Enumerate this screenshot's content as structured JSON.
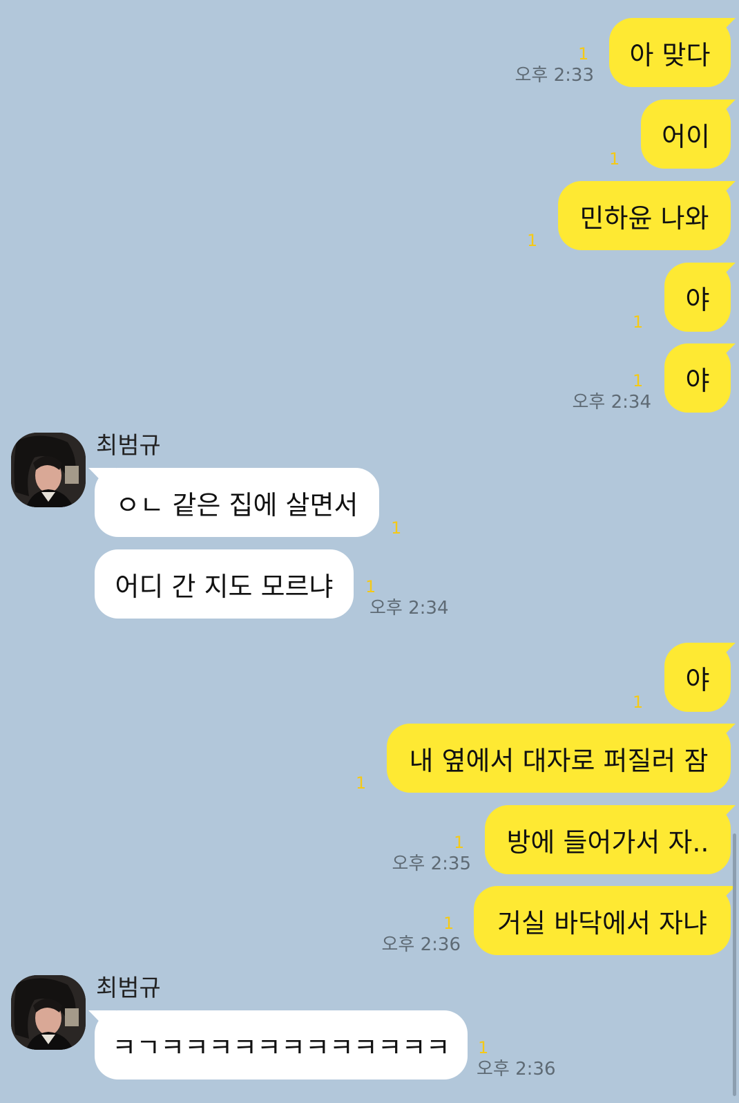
{
  "chat": {
    "messages": [
      {
        "text": "아 맞다",
        "unread": "1",
        "time": "오후 2:33"
      },
      {
        "text": "어이",
        "unread": "1"
      },
      {
        "text": "민하윤 나와",
        "unread": "1"
      },
      {
        "text": "야",
        "unread": "1"
      },
      {
        "text": "야",
        "unread": "1",
        "time": "오후 2:34"
      },
      {
        "sender": "최범규",
        "text": "ㅇㄴ 같은 집에 살면서",
        "unread": "1"
      },
      {
        "text": "어디 간 지도 모르냐",
        "unread": "1",
        "time": "오후 2:34"
      },
      {
        "text": "야",
        "unread": "1"
      },
      {
        "text": "내 옆에서 대자로 퍼질러 잠",
        "unread": "1"
      },
      {
        "text": "방에 들어가서 자..",
        "unread": "1",
        "time": "오후 2:35"
      },
      {
        "text": "거실 바닥에서 자냐",
        "unread": "1",
        "time": "오후 2:36"
      },
      {
        "sender": "최범규",
        "text": "ㅋㄱㅋㅋㅋㅋㅋㅋㅋㅋㅋㅋㅋㅋ",
        "unread": "1",
        "time": "오후 2:36"
      }
    ]
  },
  "colors": {
    "background": "#b2c7da",
    "my_bubble": "#fee933",
    "other_bubble": "#ffffff",
    "unread": "#f5c915",
    "time": "#5e6a74"
  }
}
